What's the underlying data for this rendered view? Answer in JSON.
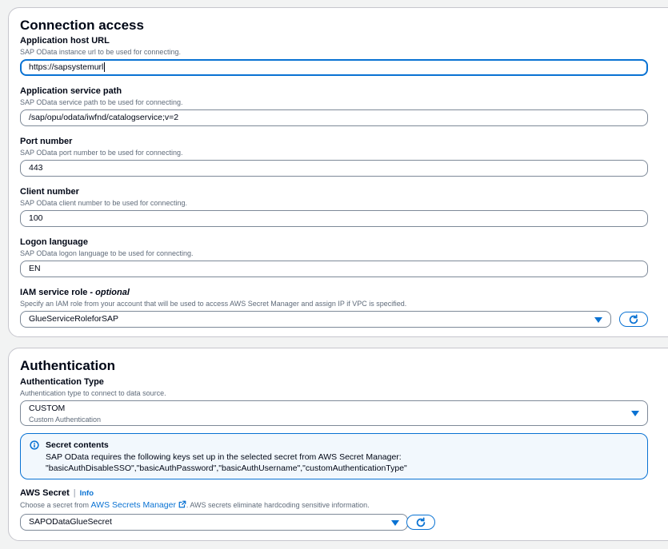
{
  "connection": {
    "title": "Connection access",
    "host_url": {
      "label": "Application host URL",
      "desc": "SAP OData instance url to be used for connecting.",
      "value": "https://sapsystemurl"
    },
    "service_path": {
      "label": "Application service path",
      "desc": "SAP OData service path to be used for connecting.",
      "value": "/sap/opu/odata/iwfnd/catalogservice;v=2"
    },
    "port": {
      "label": "Port number",
      "desc": "SAP OData port number to be used for connecting.",
      "value": "443"
    },
    "client": {
      "label": "Client number",
      "desc": "SAP OData client number to be used for connecting.",
      "value": "100"
    },
    "language": {
      "label": "Logon language",
      "desc": "SAP OData logon language to be used for connecting.",
      "value": "EN"
    },
    "iam_role": {
      "label": "IAM service role",
      "label_suffix": " - optional",
      "desc": "Specify an IAM role from your account that will be used to access AWS Secret Manager and assign IP if VPC is specified.",
      "value": "GlueServiceRoleforSAP"
    }
  },
  "authentication": {
    "title": "Authentication",
    "type": {
      "label": "Authentication Type",
      "desc": "Authentication type to connect to data source.",
      "value": "CUSTOM",
      "value_desc": "Custom Authentication"
    },
    "alert": {
      "title": "Secret contents",
      "line1": "SAP OData requires the following keys set up in the selected secret from AWS Secret Manager:",
      "line2": "\"basicAuthDisableSSO\",\"basicAuthPassword\",\"basicAuthUsername\",\"customAuthenticationType\""
    },
    "secret": {
      "label": "AWS Secret",
      "info": "Info",
      "desc_prefix": "Choose a secret from ",
      "desc_link": "AWS Secrets Manager",
      "desc_suffix": ". AWS secrets eliminate hardcoding sensitive information.",
      "value": "SAPODataGlueSecret"
    }
  },
  "colors": {
    "accent": "#0972d3",
    "border": "#7d8998",
    "text": "#000716",
    "muted": "#5f6b7a",
    "alert_bg": "#f2f8fd"
  },
  "icons": [
    "refresh-icon",
    "info-circle-icon",
    "external-link-icon",
    "caret-down-icon"
  ]
}
